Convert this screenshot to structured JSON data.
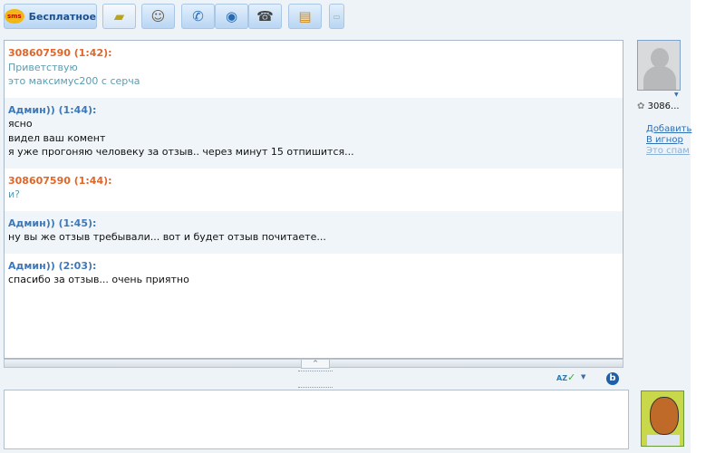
{
  "toolbar": {
    "sms_badge": "sms",
    "sms_label": "Бесплатное"
  },
  "messages": [
    {
      "sender": "308607590 (1:42):",
      "type": "in",
      "lines": [
        "Приветствую",
        "это максимус200 с серча"
      ]
    },
    {
      "sender": "Админ)) (1:44):",
      "type": "me",
      "lines": [
        "ясно",
        "видел ваш комент",
        "я уже прогоняю человеку за отзыв.. через минут 15 отпишится..."
      ]
    },
    {
      "sender": "308607590 (1:44):",
      "type": "in",
      "lines": [
        "и?"
      ]
    },
    {
      "sender": "Админ)) (1:45):",
      "type": "me",
      "lines": [
        "ну вы же отзыв требывали... вот и будет отзыв почитаете..."
      ]
    },
    {
      "sender": "Админ)) (2:03):",
      "type": "me",
      "lines": [
        "спасибо за отзыв... очень приятно"
      ]
    }
  ],
  "contact": {
    "name": "3086...",
    "add": "Добавить",
    "ignore": "В игнор",
    "spam": "Это спам"
  },
  "scroll_up": "^",
  "spell": "AZ"
}
